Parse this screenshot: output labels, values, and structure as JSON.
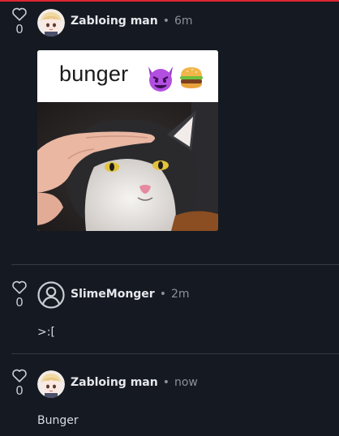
{
  "comments": [
    {
      "author": "Zabloing man",
      "time": "6m",
      "votes": "0",
      "avatar": "anime-avatar",
      "attachment": {
        "caption_text": "bunger",
        "caption_emojis": [
          "devil-face-emoji",
          "hamburger-emoji"
        ],
        "photo_subject": "cat-being-petted"
      }
    },
    {
      "author": "SlimeMonger",
      "time": "2m",
      "votes": "0",
      "avatar": "default-user-icon",
      "text": ">:["
    },
    {
      "author": "Zabloing man",
      "time": "now",
      "votes": "0",
      "avatar": "anime-avatar",
      "text": "Bunger"
    }
  ],
  "colors": {
    "background": "#151921",
    "top_accent": "#e0252f",
    "divider": "#353a44",
    "muted": "#8b919b",
    "text": "#d7dbe2"
  },
  "separator": "•"
}
